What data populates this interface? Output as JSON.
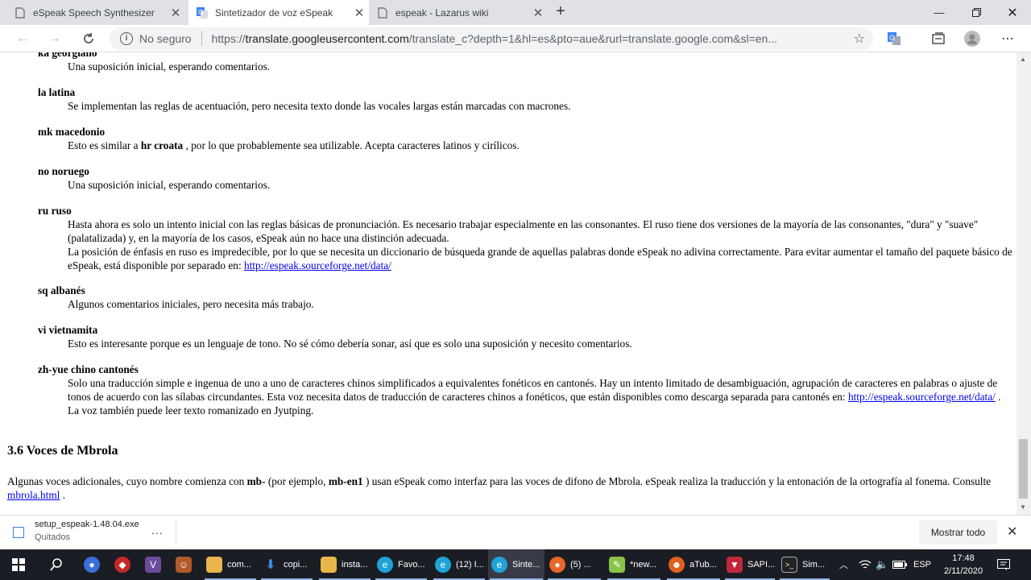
{
  "tabs": [
    {
      "title": "eSpeak Speech Synthesizer",
      "active": false
    },
    {
      "title": "Sintetizador de voz eSpeak",
      "active": true
    },
    {
      "title": "espeak - Lazarus wiki",
      "active": false
    }
  ],
  "address": {
    "security_label": "No seguro",
    "url_prefix": "https://",
    "url_host": "translate.googleusercontent.com",
    "url_rest": "/translate_c?depth=1&hl=es&pto=aue&rurl=translate.google.com&sl=en..."
  },
  "content": {
    "partial_term": "ka georgiano",
    "entries": [
      {
        "term": "",
        "def": "Una suposición inicial, esperando comentarios."
      },
      {
        "term": "la latina",
        "def": "Se implementan las reglas de acentuación, pero necesita texto donde las vocales largas están marcadas con macrones."
      },
      {
        "term": "mk macedonio",
        "def_pre": "Esto es similar a ",
        "def_bold": "hr croata",
        "def_post": " , por lo que probablemente sea utilizable. Acepta caracteres latinos y cirílicos."
      },
      {
        "term": "no noruego",
        "def": "Una suposición inicial, esperando comentarios."
      },
      {
        "term": "ru ruso",
        "def": "Hasta ahora es solo un intento inicial con las reglas básicas de pronunciación. Es necesario trabajar especialmente en las consonantes. El ruso tiene dos versiones de la mayoría de las consonantes, \"dura\" y \"suave\" (palatalizada) y, en la mayoría de los casos, eSpeak aún no hace una distinción adecuada.",
        "def2": "La posición de énfasis en ruso es impredecible, por lo que se necesita un diccionario de búsqueda grande de aquellas palabras donde eSpeak no adivina correctamente. Para evitar aumentar el tamaño del paquete básico de eSpeak, está disponible por separado en: ",
        "link": "http://espeak.sourceforge.net/data/"
      },
      {
        "term": "sq albanés",
        "def": "Algunos comentarios iniciales, pero necesita más trabajo."
      },
      {
        "term": "vi vietnamita",
        "def": "Esto es interesante porque es un lenguaje de tono. No sé cómo debería sonar, así que es solo una suposición y necesito comentarios."
      },
      {
        "term": "zh-yue chino cantonés",
        "def": "Solo una traducción simple e ingenua de uno a uno de caracteres chinos simplificados a equivalentes fonéticos en cantonés. Hay un intento limitado de desambiguación, agrupación de caracteres en palabras o ajuste de tonos de acuerdo con las sílabas circundantes. Esta voz necesita datos de traducción de caracteres chinos a fonéticos, que están disponibles como descarga separada para cantonés en: ",
        "link": "http://espeak.sourceforge.net/data/",
        "def_after": " .",
        "def2": "La voz también puede leer texto romanizado en Jyutping."
      }
    ],
    "section_heading": "3.6 Voces de Mbrola",
    "section_para": {
      "p1": "Algunas voces adicionales, cuyo nombre comienza con ",
      "b1": "mb-",
      "p2": " (por ejemplo, ",
      "b2": "mb-en1",
      "p3": " ) usan eSpeak como interfaz para las voces de difono de Mbrola. eSpeak realiza la traducción y la entonación de la ortografía al fonema. Consulte ",
      "link": "mbrola.html",
      "p4": " ."
    }
  },
  "download": {
    "filename": "setup_espeak-1.48.04.exe",
    "status": "Quitados",
    "more": "...",
    "show_all": "Mostrar todo"
  },
  "taskbar": {
    "items": [
      {
        "label": "com...",
        "icon": "folder-icon",
        "color": "#e8b64a"
      },
      {
        "label": "copi...",
        "icon": "download-arrow-icon",
        "color": "#3b8ee8"
      },
      {
        "label": "insta...",
        "icon": "folder-icon",
        "color": "#e8b64a"
      },
      {
        "label": "Favo...",
        "icon": "edge-icon",
        "color": "#1fa3d8"
      },
      {
        "label": "(12) I...",
        "icon": "edge-icon",
        "color": "#1fa3d8"
      },
      {
        "label": "Sinte...",
        "icon": "edge-icon",
        "color": "#1fa3d8"
      },
      {
        "label": "(5) ...",
        "icon": "firefox-icon",
        "color": "#e8662a"
      },
      {
        "label": "*new...",
        "icon": "notepadpp-icon",
        "color": "#8bc34a"
      },
      {
        "label": "aTub...",
        "icon": "atube-icon",
        "color": "#e06020"
      },
      {
        "label": "SAPI...",
        "icon": "sapi-icon",
        "color": "#c0283a"
      },
      {
        "label": "Sim...",
        "icon": "console-icon",
        "color": "#222222"
      }
    ],
    "language": "ESP",
    "time": "17:48",
    "date": "2/11/2020"
  }
}
